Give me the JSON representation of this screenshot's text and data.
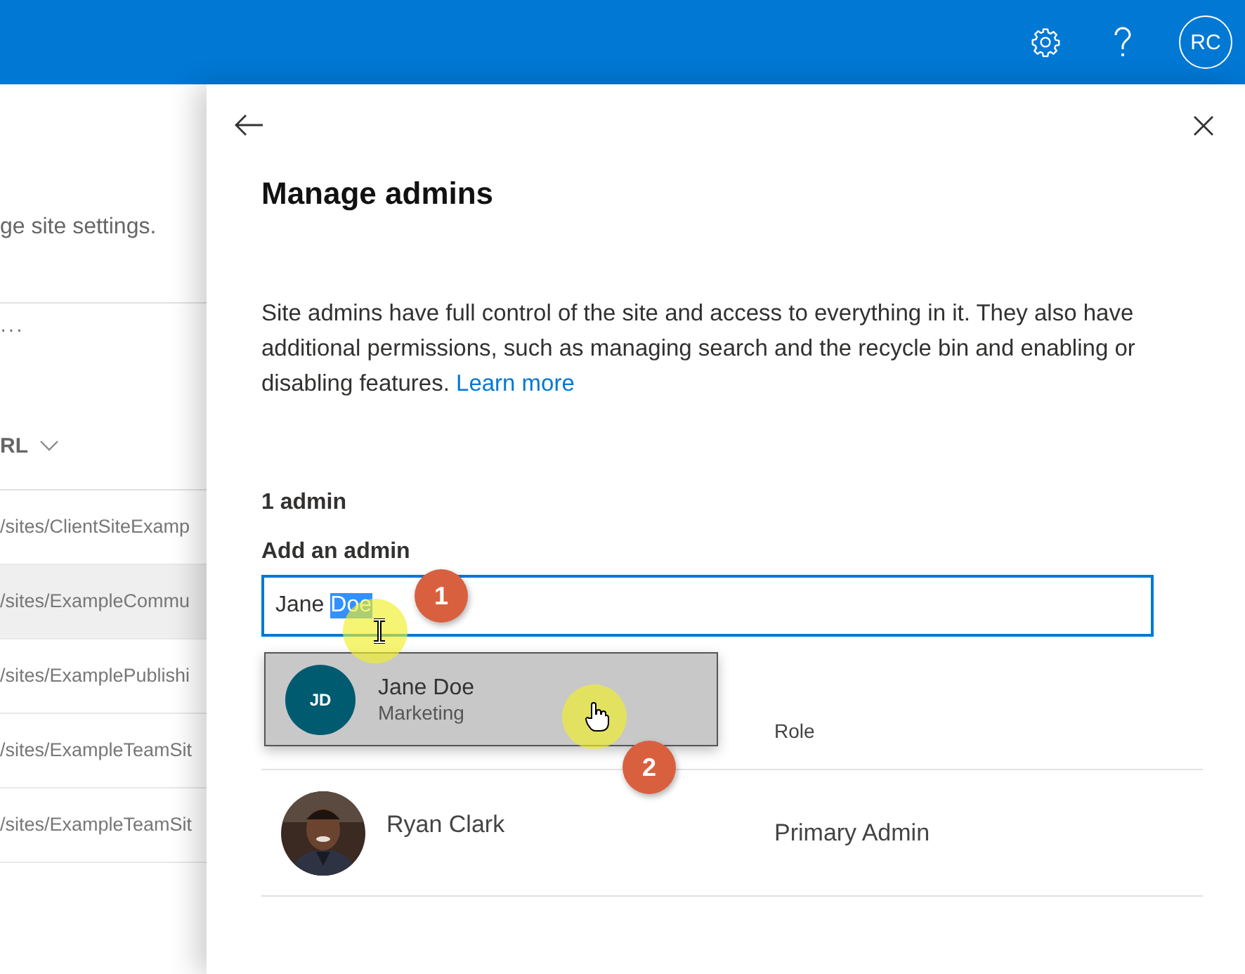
{
  "top_bar": {
    "avatar_initials": "RC"
  },
  "background_page": {
    "description_fragment": "ge site settings.",
    "more": "···",
    "column_header": "RL",
    "rows": [
      {
        "url": "/sites/ClientSiteExamp",
        "selected": false
      },
      {
        "url": "/sites/ExampleCommu",
        "selected": true
      },
      {
        "url": "/sites/ExamplePublishi",
        "selected": false
      },
      {
        "url": "/sites/ExampleTeamSit",
        "selected": false
      },
      {
        "url": "/sites/ExampleTeamSit",
        "selected": false
      }
    ]
  },
  "panel": {
    "title": "Manage admins",
    "description": "Site admins have full control of the site and access to everything in it. They also have additional permissions, such as managing search and the recycle bin and enabling or disabling features.",
    "learn_more": "Learn more",
    "admin_count": "1 admin",
    "add_label": "Add an admin",
    "field_value": [
      {
        "text": "Jane ",
        "selected": false
      },
      {
        "text": "Doe",
        "selected": true
      }
    ],
    "suggestion": {
      "initials": "JD",
      "name": "Jane Doe",
      "department": "Marketing"
    },
    "columns": [
      "Role"
    ],
    "admins": [
      {
        "name": "Ryan Clark",
        "role": "Primary Admin"
      }
    ]
  },
  "callouts": [
    "1",
    "2"
  ]
}
